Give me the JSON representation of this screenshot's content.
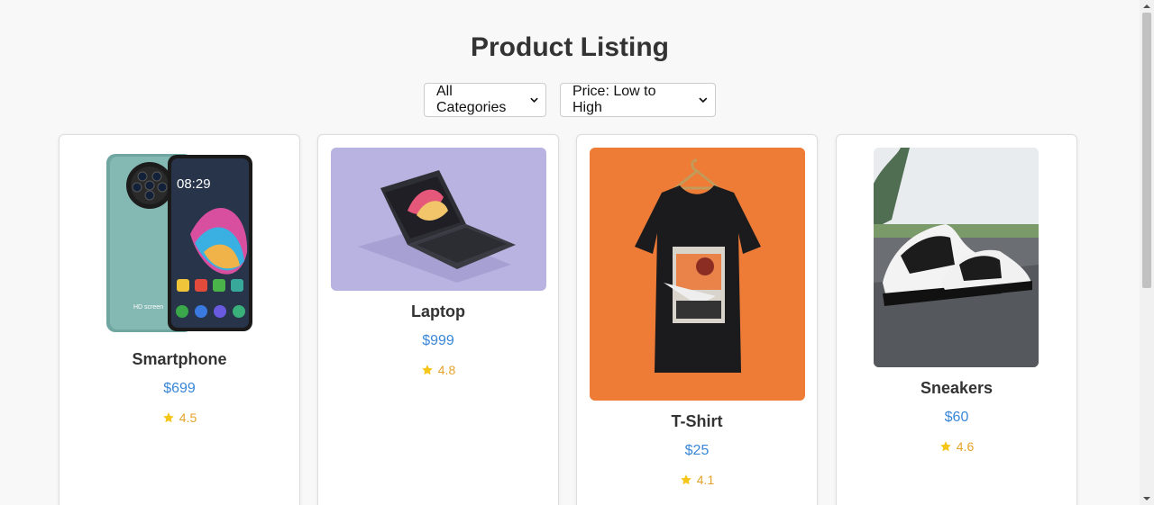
{
  "page": {
    "title": "Product Listing"
  },
  "filters": {
    "category": {
      "selected": "All Categories"
    },
    "sort": {
      "selected": "Price: Low to High"
    }
  },
  "products": [
    {
      "name": "Smartphone",
      "price": "$699",
      "rating": "4.5"
    },
    {
      "name": "Laptop",
      "price": "$999",
      "rating": "4.8"
    },
    {
      "name": "T-Shirt",
      "price": "$25",
      "rating": "4.1"
    },
    {
      "name": "Sneakers",
      "price": "$60",
      "rating": "4.6"
    }
  ],
  "phone_screen": {
    "time": "08:29",
    "caption": "HD screen"
  },
  "colors": {
    "price": "#3a87d8",
    "rating": "#e5a22b",
    "star": "#f5c518"
  }
}
